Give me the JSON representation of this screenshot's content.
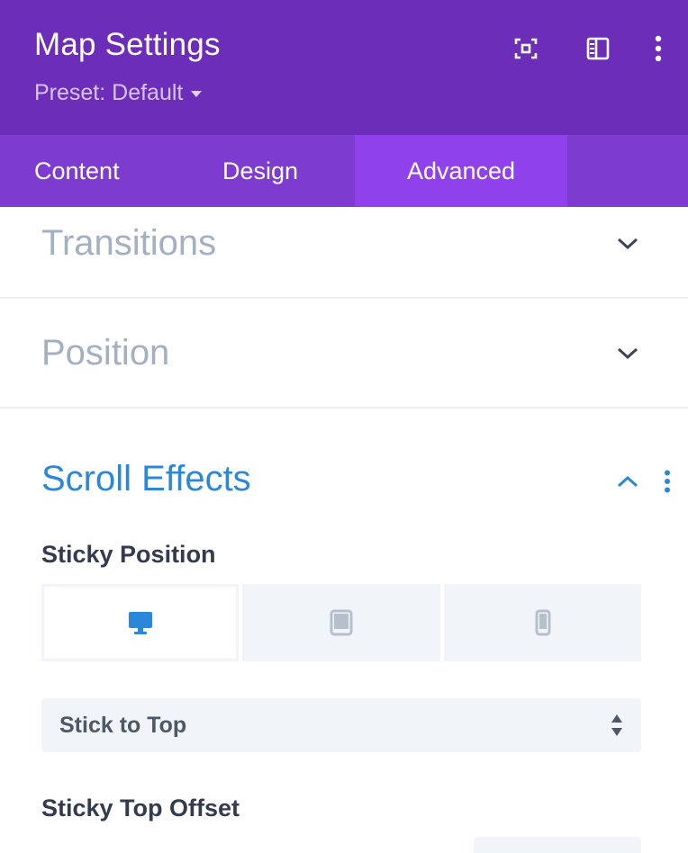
{
  "header": {
    "title": "Map Settings",
    "preset_label": "Preset: Default",
    "icons": [
      "focus-icon",
      "sidebar-layout-icon",
      "more-vertical-icon"
    ],
    "background_color": "#6c2eb9"
  },
  "tabs": [
    {
      "label": "Content",
      "active": false
    },
    {
      "label": "Design",
      "active": false
    },
    {
      "label": "Advanced",
      "active": true
    }
  ],
  "sections": {
    "transitions": {
      "title": "Transitions",
      "expanded": false
    },
    "position": {
      "title": "Position",
      "expanded": false
    },
    "scroll_effects": {
      "title": "Scroll Effects",
      "expanded": true,
      "accent_color": "#2b87da"
    }
  },
  "scroll_effects": {
    "sticky_position_label": "Sticky Position",
    "devices": [
      {
        "name": "desktop",
        "active": true
      },
      {
        "name": "tablet",
        "active": false
      },
      {
        "name": "phone",
        "active": false
      }
    ],
    "sticky_select_value": "Stick to Top",
    "sticky_top_offset_label": "Sticky Top Offset"
  }
}
